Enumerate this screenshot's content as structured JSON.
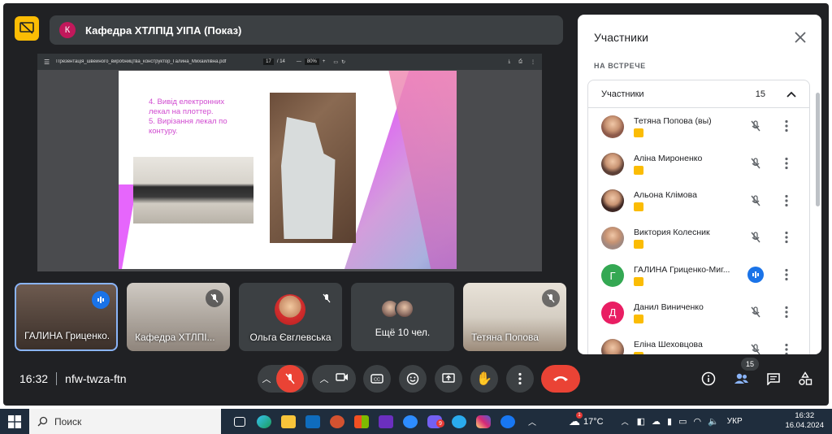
{
  "meeting": {
    "title": "Кафедра ХТЛПІД УІПА (Показ)",
    "title_avatar_letter": "К",
    "time": "16:32",
    "code": "nfw-twza-ftn"
  },
  "shared_screen": {
    "pdf_filename": "Презентація_швейного_виробництва_конструктор_Галина_Михайлівна.pdf",
    "page_current": "17",
    "page_total": "/ 14",
    "zoom": "80%",
    "slide_text_line1": "4. Вивід електронних",
    "slide_text_line2": "лекал на плоттер.",
    "slide_text_line3": "5. Вирізання лекал по",
    "slide_text_line4": "контуру."
  },
  "tiles": [
    {
      "name": "ГАЛИНА Гриценко...",
      "mic": "speaking"
    },
    {
      "name": "Кафедра ХТЛПІ...",
      "mic": "muted"
    },
    {
      "name": "Ольга Євглевська",
      "mic": "muted"
    },
    {
      "name": "Ещё 10 чел.",
      "mic": "none"
    },
    {
      "name": "Тетяна Попова",
      "mic": "muted"
    }
  ],
  "panel": {
    "title": "Участники",
    "section": "НА ВСТРЕЧЕ",
    "list_label": "Участники",
    "count": "15",
    "participants": [
      {
        "name": "Тетяна Попова (вы)",
        "mic": "muted",
        "avatar": "photo",
        "color": "#8d5a4a"
      },
      {
        "name": "Аліна Мироненко",
        "mic": "muted",
        "avatar": "photo",
        "color": "#5d4037"
      },
      {
        "name": "Альона Клімова",
        "mic": "muted",
        "avatar": "photo",
        "color": "#3e2723"
      },
      {
        "name": "Виктория Колесник",
        "mic": "muted",
        "avatar": "photo",
        "color": "#a1887f"
      },
      {
        "name": "ГАЛИНА Гриценко-Миг...",
        "mic": "speaking",
        "avatar": "letter",
        "letter": "Г",
        "color": "#34a853"
      },
      {
        "name": "Данил Виниченко",
        "mic": "muted",
        "avatar": "letter",
        "letter": "Д",
        "color": "#e91e63"
      },
      {
        "name": "Еліна Шеховцова",
        "mic": "muted",
        "avatar": "photo",
        "color": "#795548"
      }
    ]
  },
  "badge_count": "15",
  "taskbar": {
    "search_placeholder": "Поиск",
    "weather": "17°C",
    "lang": "УКР",
    "clock_time": "16:32",
    "clock_date": "16.04.2024",
    "weather_badge": "1",
    "viber_badge": "9"
  }
}
